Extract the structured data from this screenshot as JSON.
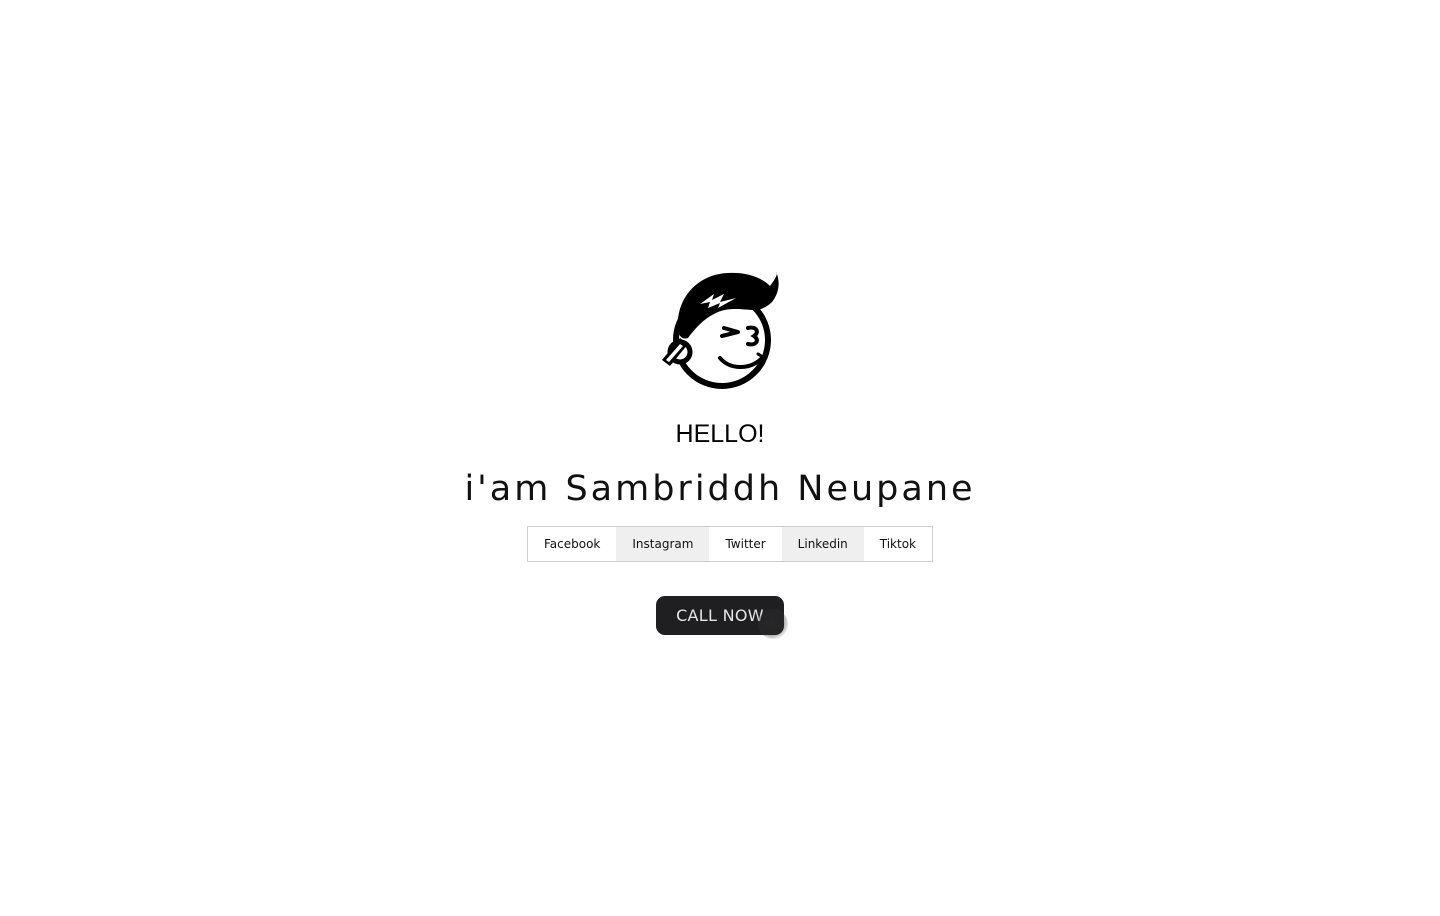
{
  "hero": {
    "avatar_icon": "cartoon-boy-face-icon",
    "greeting": "HELLO!",
    "name": "i'am Sambriddh Neupane"
  },
  "social": {
    "links": [
      {
        "label": "Facebook"
      },
      {
        "label": "Instagram"
      },
      {
        "label": "Twitter"
      },
      {
        "label": "Linkedin"
      },
      {
        "label": "Tiktok"
      }
    ]
  },
  "cta": {
    "label": "CALL NOW"
  },
  "colors": {
    "background": "#ffffff",
    "text": "#111111",
    "button_bg": "#1f1f22",
    "button_text": "#e6e6e6",
    "shaded_link_bg": "#efefef"
  }
}
